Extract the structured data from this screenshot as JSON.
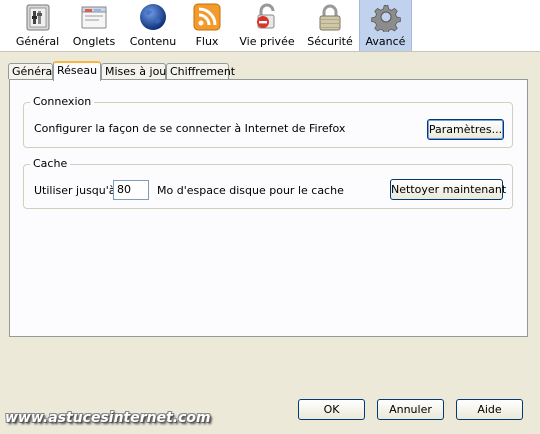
{
  "toolbar": {
    "items": [
      {
        "label": "Général",
        "icon": "switch-icon"
      },
      {
        "label": "Onglets",
        "icon": "tabs-window-icon"
      },
      {
        "label": "Contenu",
        "icon": "globe-icon"
      },
      {
        "label": "Flux",
        "icon": "rss-feed-icon"
      },
      {
        "label": "Vie privée",
        "icon": "lock-forbidden-icon"
      },
      {
        "label": "Sécurité",
        "icon": "padlock-icon"
      },
      {
        "label": "Avancé",
        "icon": "gear-icon"
      }
    ],
    "selected": "Avancé"
  },
  "tabs": [
    "Général",
    "Réseau",
    "Mises à jour",
    "Chiffrement"
  ],
  "active_tab": "Réseau",
  "connexion": {
    "title": "Connexion",
    "description": "Configurer la façon de se connecter à Internet de Firefox",
    "settings_button": "Paramètres..."
  },
  "cache": {
    "title": "Cache",
    "use_label": "Utiliser jusqu'à",
    "value": "80",
    "unit_label": "Mo d'espace disque pour le cache",
    "clear_button": "Nettoyer maintenant"
  },
  "footer": {
    "ok": "OK",
    "cancel": "Annuler",
    "help": "Aide"
  },
  "watermark": "www.astucesinternet.com",
  "colors": {
    "selected_toolbar": "#c1d2ee",
    "active_tab_accent": "#f9b640",
    "button_border": "#003c74",
    "window_bg": "#ece9d8"
  }
}
